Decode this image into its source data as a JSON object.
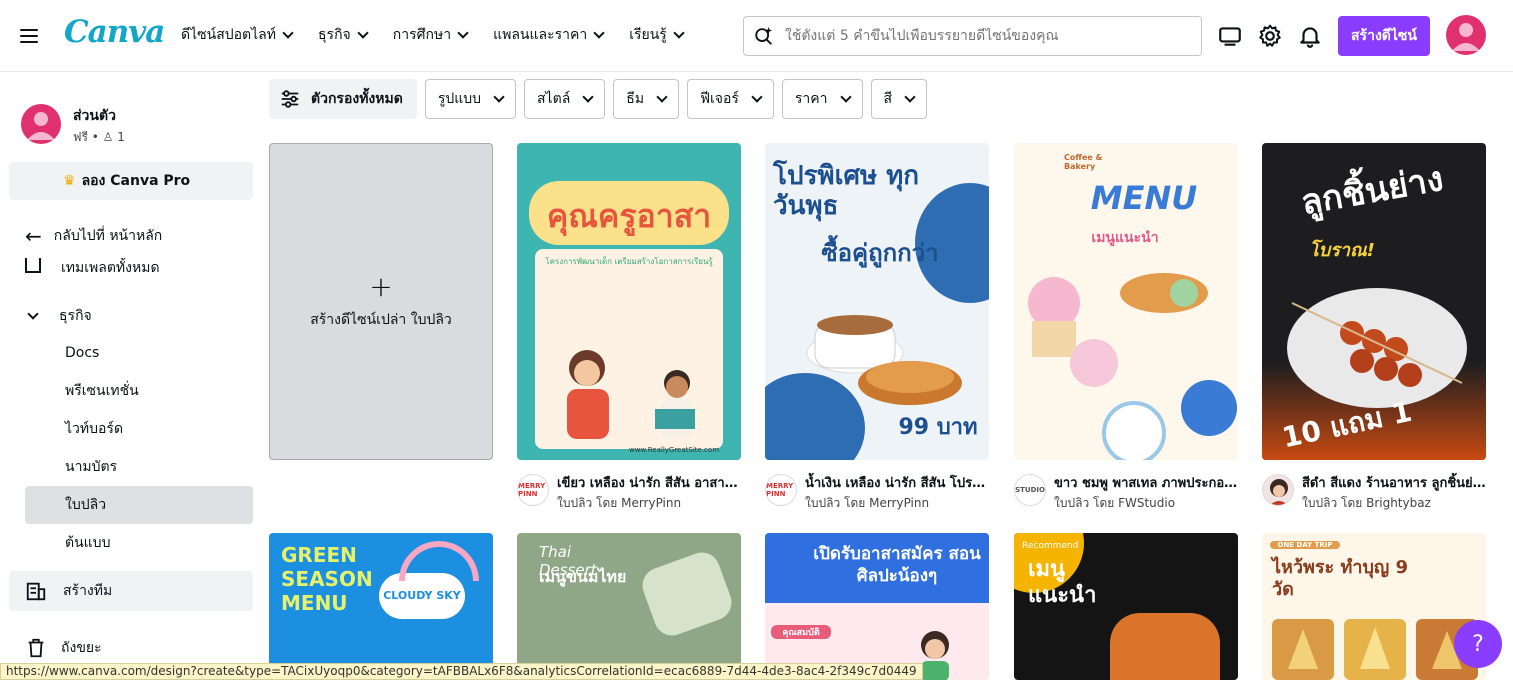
{
  "header": {
    "logo": "Canva",
    "nav": [
      "ดีไซน์สปอตไลท์",
      "ธุรกิจ",
      "การศึกษา",
      "แพลนและราคา",
      "เรียนรู้"
    ],
    "search_placeholder": "ใช้ตั้งแต่ 5 คำขึ้นไปเพื่อบรรยายดีไซน์ของคุณ",
    "create_label": "สร้างดีไซน์"
  },
  "sidebar": {
    "profile_name": "ส่วนตัว",
    "profile_meta": "ฟรี • ♙ 1",
    "pro_label": "ลอง Canva Pro",
    "back_label": "กลับไปที่ หน้าหลัก",
    "templates_label": "เทมเพลตทั้งหมด",
    "business_label": "ธุรกิจ",
    "sub_items": [
      "Docs",
      "พรีเซนเทชั่น",
      "ไวท์บอร์ด",
      "นามบัตร",
      "ใบปลิว",
      "ต้นแบบ"
    ],
    "active_item": "ใบปลิว",
    "team_label": "สร้างทีม",
    "trash_label": "ถังขยะ"
  },
  "filters": {
    "all_label": "ตัวกรองทั้งหมด",
    "items": [
      "รูปแบบ",
      "สไตล์",
      "ธีม",
      "ฟีเจอร์",
      "ราคา",
      "สี"
    ]
  },
  "blank_card_label": "สร้างดีไซน์เปล่า ใบปลิว",
  "templates": [
    {
      "title": "เขียว เหลือง น่ารัก สีสัน อาสาสมัคร",
      "by": "ใบปลิว โดย MerryPinn",
      "poster_text": "คุณครูอาสา",
      "sub_text": "โครงการพัฒนาเด็ก เตรียมสร้างโอกาสการเรียนรู้",
      "footer_text": "www.ReallyGreatSite.com",
      "brand": "MERRY PINN",
      "bg": "#3fb5b1"
    },
    {
      "title": "น้ำเงิน เหลือง น่ารัก สีสัน โปรโมชั่น",
      "by": "ใบปลิว โดย MerryPinn",
      "poster_text": "โปรพิเศษ ทุกวันพุธ",
      "sub_text": "ซื้อคู่ถูกกว่า",
      "footer_text": "99 บาท",
      "brand": "MERRY PINN",
      "bg": "#eef3f8"
    },
    {
      "title": "ขาว ชมพู พาสเทล ภาพประกอบ เมนู",
      "by": "ใบปลิว โดย FWStudio",
      "poster_text": "MENU",
      "sub_text": "เมนูแนะนำ",
      "footer_text": "Coffee & Bakery",
      "brand": "STUDIO",
      "bg": "#fdf7ec"
    },
    {
      "title": "สีดำ สีแดง ร้านอาหาร ลูกชิ้นย่าง",
      "by": "ใบปลิว โดย Brightybaz",
      "poster_text": "ลูกชิ้นย่าง",
      "sub_text": "โบราณ!",
      "footer_text": "10 แถม 1",
      "brand": "",
      "bg": "#1d1d1f"
    }
  ],
  "row2": [
    {
      "poster_text": "GREEN SEASON MENU",
      "sub_text": "CLOUDY SKY",
      "bg": "#1d8fe0"
    },
    {
      "poster_text": "Thai Dessert",
      "sub_text": "เมนูขนมไทย",
      "bg": "#8fa787"
    },
    {
      "poster_text": "เปิดรับอาสาสมัคร สอนศิลปะน้องๆ",
      "sub_text": "คุณสมบัติ",
      "bg": "#fde9ee"
    },
    {
      "poster_text": "เมนูแนะนำ",
      "sub_text": "Recommend",
      "bg": "#f4b400"
    },
    {
      "poster_text": "ไหว้พระ ทำบุญ 9 วัด",
      "sub_text": "ONE DAY TRIP",
      "bg": "#fff6ea"
    }
  ],
  "status_url": "https://www.canva.com/design?create&type=TACixUyoqp0&category=tAFBBALx6F8&analyticsCorrelationId=ecac6889-7d44-4de3-8ac4-2f349c7d0449",
  "help_label": "?",
  "colors": {
    "accent": "#8b3dff",
    "logo": "#12a6c9",
    "avatar": "#e0316e"
  }
}
